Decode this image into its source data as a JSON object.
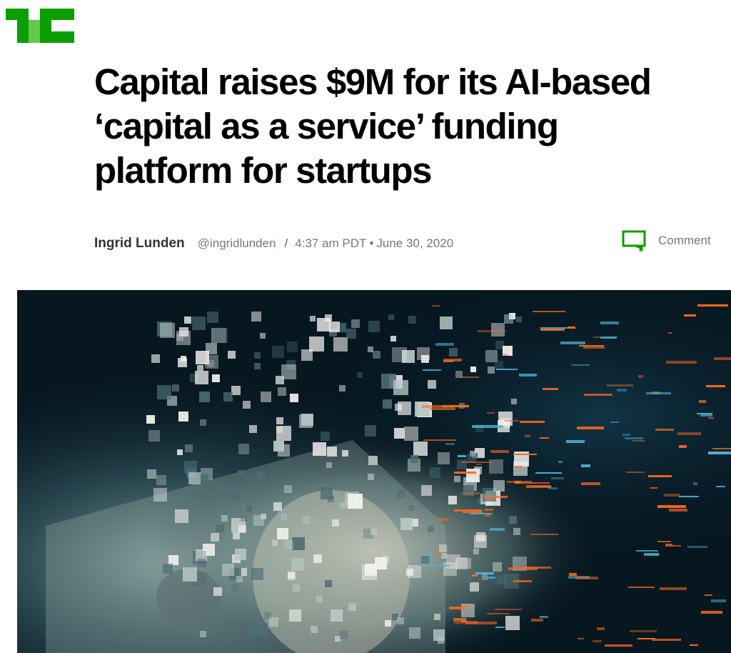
{
  "brand": {
    "logo_text": "TC",
    "accent_color": "#0a9e01",
    "logo_icon": "techcrunch-logo-icon"
  },
  "article": {
    "title": "Capital raises $9M for its AI-based ‘capital as a service’ funding platform for startups",
    "author": "Ingrid Lunden",
    "handle": "@ingridlunden",
    "separator": "/",
    "time": "4:37 am PDT",
    "bullet": "•",
    "date": "June 30, 2020"
  },
  "actions": {
    "comment_label": "Comment",
    "comment_icon": "comment-bubble-icon"
  },
  "hero_image": {
    "subject": "digitized dollar bill dissolving into pixels",
    "icon": "hero-image"
  }
}
